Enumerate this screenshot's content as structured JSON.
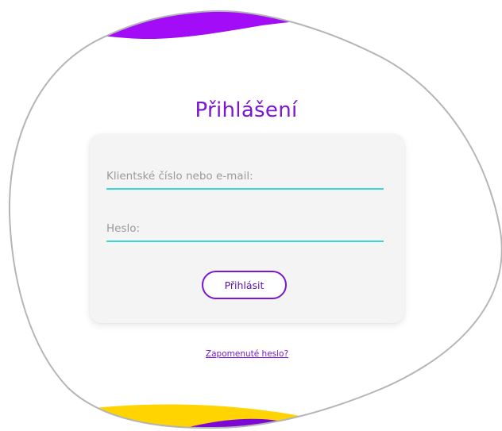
{
  "login": {
    "title": "Přihlášení",
    "client_placeholder": "Klientské číslo nebo e-mail:",
    "password_placeholder": "Heslo:",
    "submit_label": "Přihlásit",
    "forgot_label": "Zapomenuté heslo?"
  },
  "colors": {
    "accent_purple": "#7a16d4",
    "input_underline": "#3ad7d7",
    "blob_purple": "#a20cf6",
    "blob_yellow": "#ffd400",
    "blob_dark_purple": "#7d08d6",
    "card_bg": "#f4f4f4"
  }
}
